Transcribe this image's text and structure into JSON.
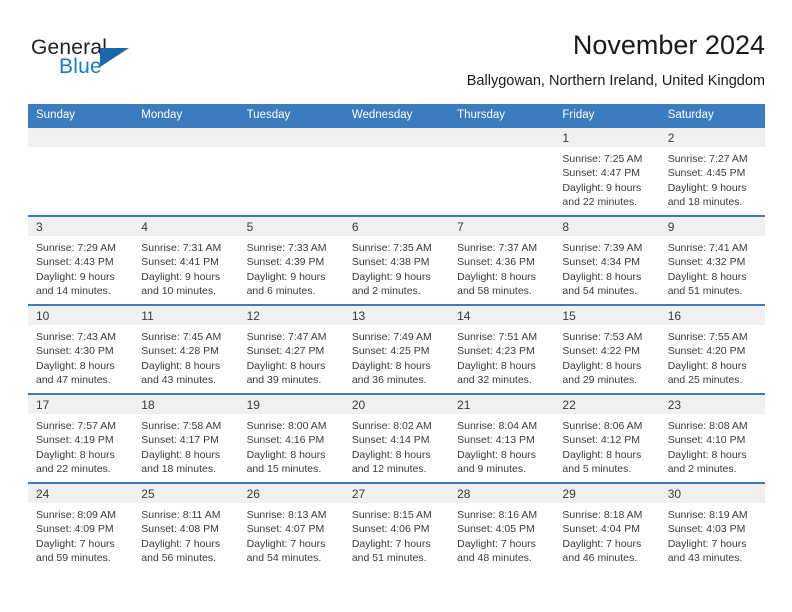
{
  "logo": {
    "text_top": "General",
    "text_bottom": "Blue",
    "triangle_color": "#1868ab",
    "blue_color": "#1c7cc0"
  },
  "header": {
    "title": "November 2024",
    "subtitle": "Ballygowan, Northern Ireland, United Kingdom"
  },
  "theme": {
    "header_blue": "#3b7cbe",
    "daynum_strip": "#f0f0f0",
    "text": "#3a3a3a"
  },
  "weekdays": [
    "Sunday",
    "Monday",
    "Tuesday",
    "Wednesday",
    "Thursday",
    "Friday",
    "Saturday"
  ],
  "weeks": [
    [
      {
        "empty": true
      },
      {
        "empty": true
      },
      {
        "empty": true
      },
      {
        "empty": true
      },
      {
        "empty": true
      },
      {
        "day": "1",
        "sunrise": "Sunrise: 7:25 AM",
        "sunset": "Sunset: 4:47 PM",
        "daylight_1": "Daylight: 9 hours",
        "daylight_2": "and 22 minutes."
      },
      {
        "day": "2",
        "sunrise": "Sunrise: 7:27 AM",
        "sunset": "Sunset: 4:45 PM",
        "daylight_1": "Daylight: 9 hours",
        "daylight_2": "and 18 minutes."
      }
    ],
    [
      {
        "day": "3",
        "sunrise": "Sunrise: 7:29 AM",
        "sunset": "Sunset: 4:43 PM",
        "daylight_1": "Daylight: 9 hours",
        "daylight_2": "and 14 minutes."
      },
      {
        "day": "4",
        "sunrise": "Sunrise: 7:31 AM",
        "sunset": "Sunset: 4:41 PM",
        "daylight_1": "Daylight: 9 hours",
        "daylight_2": "and 10 minutes."
      },
      {
        "day": "5",
        "sunrise": "Sunrise: 7:33 AM",
        "sunset": "Sunset: 4:39 PM",
        "daylight_1": "Daylight: 9 hours",
        "daylight_2": "and 6 minutes."
      },
      {
        "day": "6",
        "sunrise": "Sunrise: 7:35 AM",
        "sunset": "Sunset: 4:38 PM",
        "daylight_1": "Daylight: 9 hours",
        "daylight_2": "and 2 minutes."
      },
      {
        "day": "7",
        "sunrise": "Sunrise: 7:37 AM",
        "sunset": "Sunset: 4:36 PM",
        "daylight_1": "Daylight: 8 hours",
        "daylight_2": "and 58 minutes."
      },
      {
        "day": "8",
        "sunrise": "Sunrise: 7:39 AM",
        "sunset": "Sunset: 4:34 PM",
        "daylight_1": "Daylight: 8 hours",
        "daylight_2": "and 54 minutes."
      },
      {
        "day": "9",
        "sunrise": "Sunrise: 7:41 AM",
        "sunset": "Sunset: 4:32 PM",
        "daylight_1": "Daylight: 8 hours",
        "daylight_2": "and 51 minutes."
      }
    ],
    [
      {
        "day": "10",
        "sunrise": "Sunrise: 7:43 AM",
        "sunset": "Sunset: 4:30 PM",
        "daylight_1": "Daylight: 8 hours",
        "daylight_2": "and 47 minutes."
      },
      {
        "day": "11",
        "sunrise": "Sunrise: 7:45 AM",
        "sunset": "Sunset: 4:28 PM",
        "daylight_1": "Daylight: 8 hours",
        "daylight_2": "and 43 minutes."
      },
      {
        "day": "12",
        "sunrise": "Sunrise: 7:47 AM",
        "sunset": "Sunset: 4:27 PM",
        "daylight_1": "Daylight: 8 hours",
        "daylight_2": "and 39 minutes."
      },
      {
        "day": "13",
        "sunrise": "Sunrise: 7:49 AM",
        "sunset": "Sunset: 4:25 PM",
        "daylight_1": "Daylight: 8 hours",
        "daylight_2": "and 36 minutes."
      },
      {
        "day": "14",
        "sunrise": "Sunrise: 7:51 AM",
        "sunset": "Sunset: 4:23 PM",
        "daylight_1": "Daylight: 8 hours",
        "daylight_2": "and 32 minutes."
      },
      {
        "day": "15",
        "sunrise": "Sunrise: 7:53 AM",
        "sunset": "Sunset: 4:22 PM",
        "daylight_1": "Daylight: 8 hours",
        "daylight_2": "and 29 minutes."
      },
      {
        "day": "16",
        "sunrise": "Sunrise: 7:55 AM",
        "sunset": "Sunset: 4:20 PM",
        "daylight_1": "Daylight: 8 hours",
        "daylight_2": "and 25 minutes."
      }
    ],
    [
      {
        "day": "17",
        "sunrise": "Sunrise: 7:57 AM",
        "sunset": "Sunset: 4:19 PM",
        "daylight_1": "Daylight: 8 hours",
        "daylight_2": "and 22 minutes."
      },
      {
        "day": "18",
        "sunrise": "Sunrise: 7:58 AM",
        "sunset": "Sunset: 4:17 PM",
        "daylight_1": "Daylight: 8 hours",
        "daylight_2": "and 18 minutes."
      },
      {
        "day": "19",
        "sunrise": "Sunrise: 8:00 AM",
        "sunset": "Sunset: 4:16 PM",
        "daylight_1": "Daylight: 8 hours",
        "daylight_2": "and 15 minutes."
      },
      {
        "day": "20",
        "sunrise": "Sunrise: 8:02 AM",
        "sunset": "Sunset: 4:14 PM",
        "daylight_1": "Daylight: 8 hours",
        "daylight_2": "and 12 minutes."
      },
      {
        "day": "21",
        "sunrise": "Sunrise: 8:04 AM",
        "sunset": "Sunset: 4:13 PM",
        "daylight_1": "Daylight: 8 hours",
        "daylight_2": "and 9 minutes."
      },
      {
        "day": "22",
        "sunrise": "Sunrise: 8:06 AM",
        "sunset": "Sunset: 4:12 PM",
        "daylight_1": "Daylight: 8 hours",
        "daylight_2": "and 5 minutes."
      },
      {
        "day": "23",
        "sunrise": "Sunrise: 8:08 AM",
        "sunset": "Sunset: 4:10 PM",
        "daylight_1": "Daylight: 8 hours",
        "daylight_2": "and 2 minutes."
      }
    ],
    [
      {
        "day": "24",
        "sunrise": "Sunrise: 8:09 AM",
        "sunset": "Sunset: 4:09 PM",
        "daylight_1": "Daylight: 7 hours",
        "daylight_2": "and 59 minutes."
      },
      {
        "day": "25",
        "sunrise": "Sunrise: 8:11 AM",
        "sunset": "Sunset: 4:08 PM",
        "daylight_1": "Daylight: 7 hours",
        "daylight_2": "and 56 minutes."
      },
      {
        "day": "26",
        "sunrise": "Sunrise: 8:13 AM",
        "sunset": "Sunset: 4:07 PM",
        "daylight_1": "Daylight: 7 hours",
        "daylight_2": "and 54 minutes."
      },
      {
        "day": "27",
        "sunrise": "Sunrise: 8:15 AM",
        "sunset": "Sunset: 4:06 PM",
        "daylight_1": "Daylight: 7 hours",
        "daylight_2": "and 51 minutes."
      },
      {
        "day": "28",
        "sunrise": "Sunrise: 8:16 AM",
        "sunset": "Sunset: 4:05 PM",
        "daylight_1": "Daylight: 7 hours",
        "daylight_2": "and 48 minutes."
      },
      {
        "day": "29",
        "sunrise": "Sunrise: 8:18 AM",
        "sunset": "Sunset: 4:04 PM",
        "daylight_1": "Daylight: 7 hours",
        "daylight_2": "and 46 minutes."
      },
      {
        "day": "30",
        "sunrise": "Sunrise: 8:19 AM",
        "sunset": "Sunset: 4:03 PM",
        "daylight_1": "Daylight: 7 hours",
        "daylight_2": "and 43 minutes."
      }
    ]
  ]
}
